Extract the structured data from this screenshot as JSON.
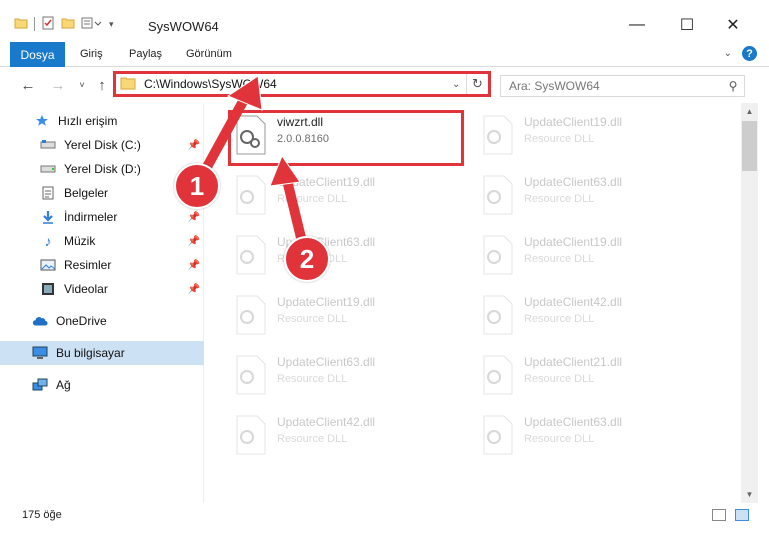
{
  "window": {
    "title": "SysWOW64",
    "controls": [
      "minimize-icon",
      "maximize-icon",
      "close-icon"
    ]
  },
  "ribbon": {
    "file_tab": "Dosya",
    "tabs": [
      "Giriş",
      "Paylaş",
      "Görünüm"
    ]
  },
  "address_bar": {
    "path": "C:\\Windows\\SysWOW64",
    "search_placeholder": "Ara: SysWOW64"
  },
  "sidebar": {
    "items": [
      {
        "label": "Hızlı erişim",
        "icon": "star-icon"
      },
      {
        "label": "Yerel Disk (C:)",
        "icon": "drive-icon",
        "pinned": true
      },
      {
        "label": "Yerel Disk (D:)",
        "icon": "drive-icon"
      },
      {
        "label": "Belgeler",
        "icon": "document-icon"
      },
      {
        "label": "İndirmeler",
        "icon": "download-icon",
        "pinned": true
      },
      {
        "label": "Müzik",
        "icon": "music-icon",
        "pinned": true
      },
      {
        "label": "Resimler",
        "icon": "pictures-icon",
        "pinned": true
      },
      {
        "label": "Videolar",
        "icon": "video-icon",
        "pinned": true
      },
      {
        "label": "OneDrive",
        "icon": "cloud-icon"
      },
      {
        "label": "Bu bilgisayar",
        "icon": "computer-icon",
        "selected": true
      },
      {
        "label": "Ağ",
        "icon": "network-icon"
      }
    ]
  },
  "files": [
    {
      "name": "viwzrt.dll",
      "sub": "2.0.0.8160",
      "highlighted": true
    },
    {
      "name": "UpdateClient19.dll",
      "sub": "Resource DLL"
    },
    {
      "name": "UpdateClient19.dll",
      "sub": "Resource DLL"
    },
    {
      "name": "UpdateClient63.dll",
      "sub": "Resource DLL"
    },
    {
      "name": "UpdateClient63.dll",
      "sub": "Resource DLL"
    },
    {
      "name": "UpdateClient19.dll",
      "sub": "Resource DLL"
    },
    {
      "name": "UpdateClient19.dll",
      "sub": "Resource DLL"
    },
    {
      "name": "UpdateClient42.dll",
      "sub": "Resource DLL"
    },
    {
      "name": "UpdateClient63.dll",
      "sub": "Resource DLL"
    },
    {
      "name": "UpdateClient21.dll",
      "sub": "Resource DLL"
    },
    {
      "name": "UpdateClient42.dll",
      "sub": "Resource DLL"
    },
    {
      "name": "UpdateClient63.dll",
      "sub": "Resource DLL"
    }
  ],
  "status": {
    "item_count": "175 öğe"
  },
  "annotations": {
    "callout_1": "1",
    "callout_2": "2",
    "color": "#e0343a"
  }
}
